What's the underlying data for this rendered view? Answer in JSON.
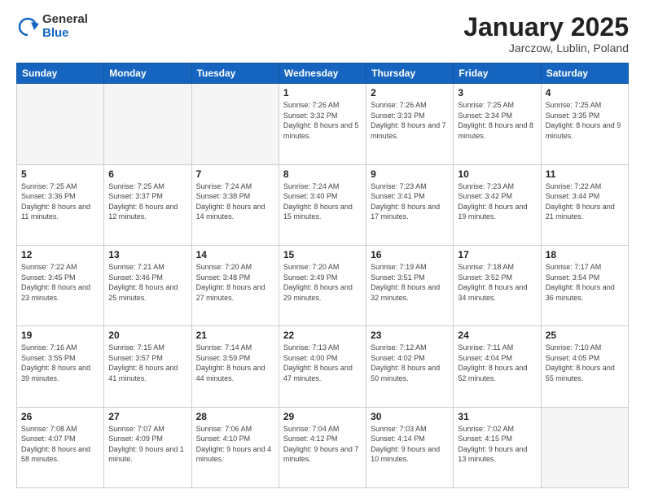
{
  "logo": {
    "general": "General",
    "blue": "Blue"
  },
  "title": "January 2025",
  "subtitle": "Jarczow, Lublin, Poland",
  "weekdays": [
    "Sunday",
    "Monday",
    "Tuesday",
    "Wednesday",
    "Thursday",
    "Friday",
    "Saturday"
  ],
  "weeks": [
    [
      {
        "day": "",
        "info": ""
      },
      {
        "day": "",
        "info": ""
      },
      {
        "day": "",
        "info": ""
      },
      {
        "day": "1",
        "info": "Sunrise: 7:26 AM\nSunset: 3:32 PM\nDaylight: 8 hours\nand 5 minutes."
      },
      {
        "day": "2",
        "info": "Sunrise: 7:26 AM\nSunset: 3:33 PM\nDaylight: 8 hours\nand 7 minutes."
      },
      {
        "day": "3",
        "info": "Sunrise: 7:25 AM\nSunset: 3:34 PM\nDaylight: 8 hours\nand 8 minutes."
      },
      {
        "day": "4",
        "info": "Sunrise: 7:25 AM\nSunset: 3:35 PM\nDaylight: 8 hours\nand 9 minutes."
      }
    ],
    [
      {
        "day": "5",
        "info": "Sunrise: 7:25 AM\nSunset: 3:36 PM\nDaylight: 8 hours\nand 11 minutes."
      },
      {
        "day": "6",
        "info": "Sunrise: 7:25 AM\nSunset: 3:37 PM\nDaylight: 8 hours\nand 12 minutes."
      },
      {
        "day": "7",
        "info": "Sunrise: 7:24 AM\nSunset: 3:38 PM\nDaylight: 8 hours\nand 14 minutes."
      },
      {
        "day": "8",
        "info": "Sunrise: 7:24 AM\nSunset: 3:40 PM\nDaylight: 8 hours\nand 15 minutes."
      },
      {
        "day": "9",
        "info": "Sunrise: 7:23 AM\nSunset: 3:41 PM\nDaylight: 8 hours\nand 17 minutes."
      },
      {
        "day": "10",
        "info": "Sunrise: 7:23 AM\nSunset: 3:42 PM\nDaylight: 8 hours\nand 19 minutes."
      },
      {
        "day": "11",
        "info": "Sunrise: 7:22 AM\nSunset: 3:44 PM\nDaylight: 8 hours\nand 21 minutes."
      }
    ],
    [
      {
        "day": "12",
        "info": "Sunrise: 7:22 AM\nSunset: 3:45 PM\nDaylight: 8 hours\nand 23 minutes."
      },
      {
        "day": "13",
        "info": "Sunrise: 7:21 AM\nSunset: 3:46 PM\nDaylight: 8 hours\nand 25 minutes."
      },
      {
        "day": "14",
        "info": "Sunrise: 7:20 AM\nSunset: 3:48 PM\nDaylight: 8 hours\nand 27 minutes."
      },
      {
        "day": "15",
        "info": "Sunrise: 7:20 AM\nSunset: 3:49 PM\nDaylight: 8 hours\nand 29 minutes."
      },
      {
        "day": "16",
        "info": "Sunrise: 7:19 AM\nSunset: 3:51 PM\nDaylight: 8 hours\nand 32 minutes."
      },
      {
        "day": "17",
        "info": "Sunrise: 7:18 AM\nSunset: 3:52 PM\nDaylight: 8 hours\nand 34 minutes."
      },
      {
        "day": "18",
        "info": "Sunrise: 7:17 AM\nSunset: 3:54 PM\nDaylight: 8 hours\nand 36 minutes."
      }
    ],
    [
      {
        "day": "19",
        "info": "Sunrise: 7:16 AM\nSunset: 3:55 PM\nDaylight: 8 hours\nand 39 minutes."
      },
      {
        "day": "20",
        "info": "Sunrise: 7:15 AM\nSunset: 3:57 PM\nDaylight: 8 hours\nand 41 minutes."
      },
      {
        "day": "21",
        "info": "Sunrise: 7:14 AM\nSunset: 3:59 PM\nDaylight: 8 hours\nand 44 minutes."
      },
      {
        "day": "22",
        "info": "Sunrise: 7:13 AM\nSunset: 4:00 PM\nDaylight: 8 hours\nand 47 minutes."
      },
      {
        "day": "23",
        "info": "Sunrise: 7:12 AM\nSunset: 4:02 PM\nDaylight: 8 hours\nand 50 minutes."
      },
      {
        "day": "24",
        "info": "Sunrise: 7:11 AM\nSunset: 4:04 PM\nDaylight: 8 hours\nand 52 minutes."
      },
      {
        "day": "25",
        "info": "Sunrise: 7:10 AM\nSunset: 4:05 PM\nDaylight: 8 hours\nand 55 minutes."
      }
    ],
    [
      {
        "day": "26",
        "info": "Sunrise: 7:08 AM\nSunset: 4:07 PM\nDaylight: 8 hours\nand 58 minutes."
      },
      {
        "day": "27",
        "info": "Sunrise: 7:07 AM\nSunset: 4:09 PM\nDaylight: 9 hours\nand 1 minute."
      },
      {
        "day": "28",
        "info": "Sunrise: 7:06 AM\nSunset: 4:10 PM\nDaylight: 9 hours\nand 4 minutes."
      },
      {
        "day": "29",
        "info": "Sunrise: 7:04 AM\nSunset: 4:12 PM\nDaylight: 9 hours\nand 7 minutes."
      },
      {
        "day": "30",
        "info": "Sunrise: 7:03 AM\nSunset: 4:14 PM\nDaylight: 9 hours\nand 10 minutes."
      },
      {
        "day": "31",
        "info": "Sunrise: 7:02 AM\nSunset: 4:15 PM\nDaylight: 9 hours\nand 13 minutes."
      },
      {
        "day": "",
        "info": ""
      }
    ]
  ]
}
